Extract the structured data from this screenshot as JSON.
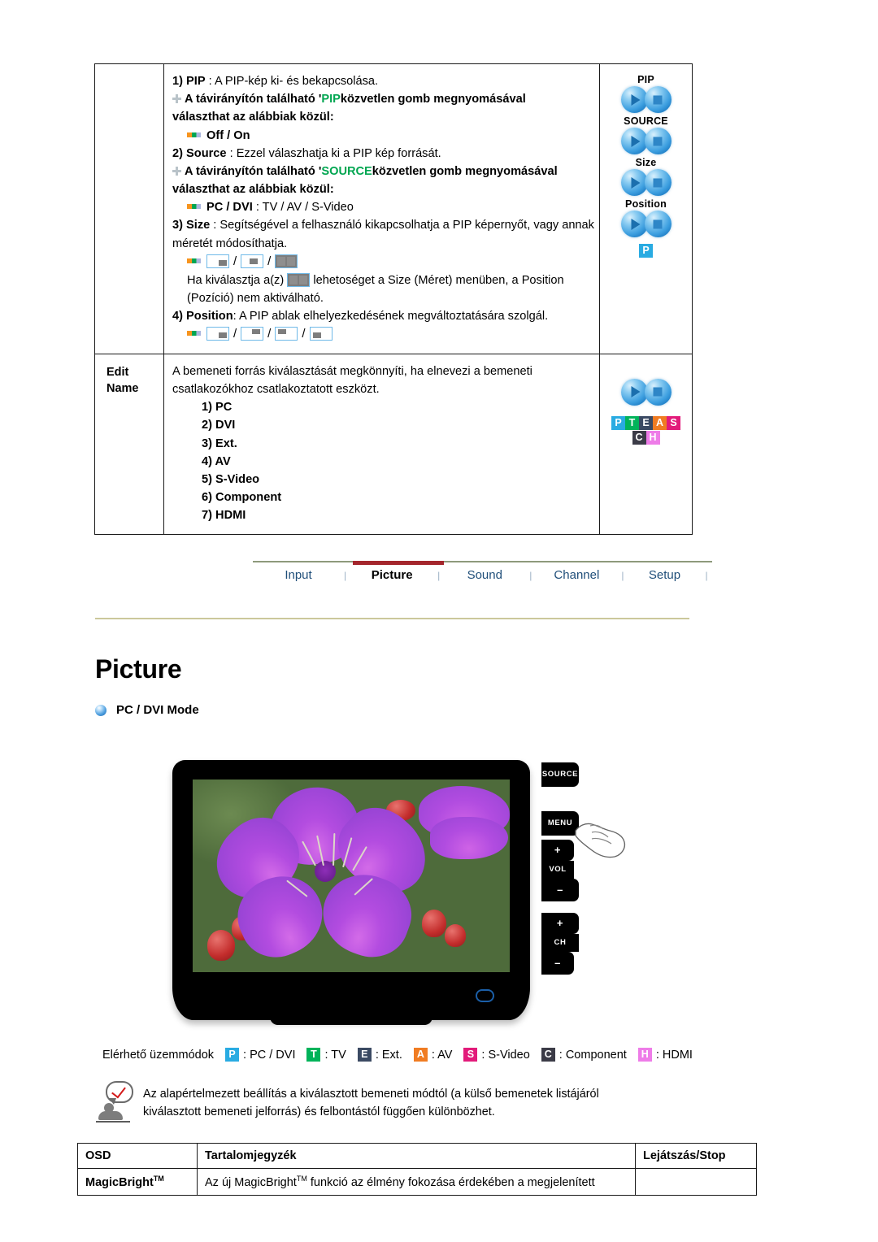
{
  "pip_table": {
    "rows": [
      {
        "label": "",
        "items": [
          {
            "num": "1)",
            "term": "PIP",
            "sep": " : ",
            "desc": "A PIP-kép ki- és bekapcsolása."
          },
          {
            "prefix": "A távirányítón található '",
            "highlight": "PIP",
            "suffix": "közvetlen gomb megnyomásával"
          },
          {
            "cont": "választhat az alábbiak közül:"
          },
          {
            "bullet": "Off / On"
          },
          {
            "num": "2)",
            "term": "Source",
            "sep": " : ",
            "desc": "Ezzel válaszhatja ki a PIP kép forrását."
          },
          {
            "prefix": "A távirányítón található '",
            "highlight": "SOURCE",
            "suffix": "közvetlen gomb megnyomásával"
          },
          {
            "cont": "választhat az alábbiak közül:"
          },
          {
            "bullet_bold": "PC / DVI",
            "bullet_rest": " : TV / AV / S-Video"
          },
          {
            "num": "3)",
            "term": "Size",
            "sep": " : ",
            "desc": "Segítségével a felhasználó kikapcsolhatja a PIP képernyőt, vagy annak méretét módosíthatja."
          },
          {
            "icons_size": true
          },
          {
            "note_a": "Ha kiválasztja a(z)",
            "note_b": "lehetoséget a Size (Méret) menüben, a Position (Pozíció) nem aktiválható."
          },
          {
            "num": "4)",
            "term": "Position",
            "sep": ": ",
            "desc": "A PIP ablak elhelyezkedésének megváltoztatására szolgál."
          },
          {
            "icons_position": true
          }
        ],
        "buttons": [
          {
            "caption": "PIP"
          },
          {
            "caption": "SOURCE"
          },
          {
            "caption": "Size"
          },
          {
            "caption": "Position"
          }
        ],
        "badge": {
          "letter": "P",
          "color": "#29abe2"
        }
      }
    ],
    "edit_name": {
      "label_line1": "Edit",
      "label_line2": "Name",
      "desc": "A bemeneti forrás kiválasztását megkönnyíti, ha elnevezi a bemeneti csatlakozókhoz csatlakoztatott eszközt.",
      "options": [
        "1) PC",
        "2) DVI",
        "3) Ext.",
        "4) AV",
        "5) S-Video",
        "6) Component",
        "7) HDMI"
      ],
      "badges_row1": [
        {
          "letter": "P",
          "color": "#29abe2"
        },
        {
          "letter": "T",
          "color": "#00b35a"
        },
        {
          "letter": "E",
          "color": "#3b4a63"
        },
        {
          "letter": "A",
          "color": "#f07c22"
        },
        {
          "letter": "S",
          "color": "#e21b7a"
        }
      ],
      "badges_row2": [
        {
          "letter": "C",
          "color": "#3b3b47"
        },
        {
          "letter": "H",
          "color": "#ee7ce8"
        }
      ]
    }
  },
  "nav": {
    "items": [
      {
        "label": "Input",
        "active": false
      },
      {
        "label": "Picture",
        "active": true
      },
      {
        "label": "Sound",
        "active": false
      },
      {
        "label": "Channel",
        "active": false
      },
      {
        "label": "Setup",
        "active": false
      }
    ],
    "separator": "|",
    "active_color": "#a4262c"
  },
  "section": {
    "title": "Picture",
    "subhead": "PC / DVI Mode"
  },
  "monitor": {
    "side_buttons": [
      "SOURCE",
      "MENU",
      "+",
      "VOL",
      "–",
      "+",
      "CH",
      "–"
    ]
  },
  "legend": {
    "label": "Elérhető üzemmódok",
    "items": [
      {
        "letter": "P",
        "color": "#29abe2",
        "text": ": PC / DVI"
      },
      {
        "letter": "T",
        "color": "#00b35a",
        "text": ": TV"
      },
      {
        "letter": "E",
        "color": "#3b4a63",
        "text": ": Ext."
      },
      {
        "letter": "A",
        "color": "#f07c22",
        "text": ": AV"
      },
      {
        "letter": "S",
        "color": "#e21b7a",
        "text": ": S-Video"
      },
      {
        "letter": "C",
        "color": "#3b3b47",
        "text": ": Component"
      },
      {
        "letter": "H",
        "color": "#ee7ce8",
        "text": ": HDMI"
      }
    ]
  },
  "note": {
    "line1": "Az alapértelmezett beállítás a kiválasztott bemeneti módtól (a külső bemenetek listájáról",
    "line2": "kiválasztott bemeneti jelforrás) és felbontástól függően különbözhet."
  },
  "osd_table": {
    "headers": [
      "OSD",
      "Tartalomjegyzék",
      "Lejátszás/Stop"
    ],
    "rows": [
      {
        "osd_main": "MagicBright",
        "osd_sup": "TM",
        "content_a": "Az új MagicBright",
        "content_sup": "TM",
        "content_b": " funkció az élmény fokozása érdekében a megjelenített",
        "play": ""
      }
    ]
  }
}
